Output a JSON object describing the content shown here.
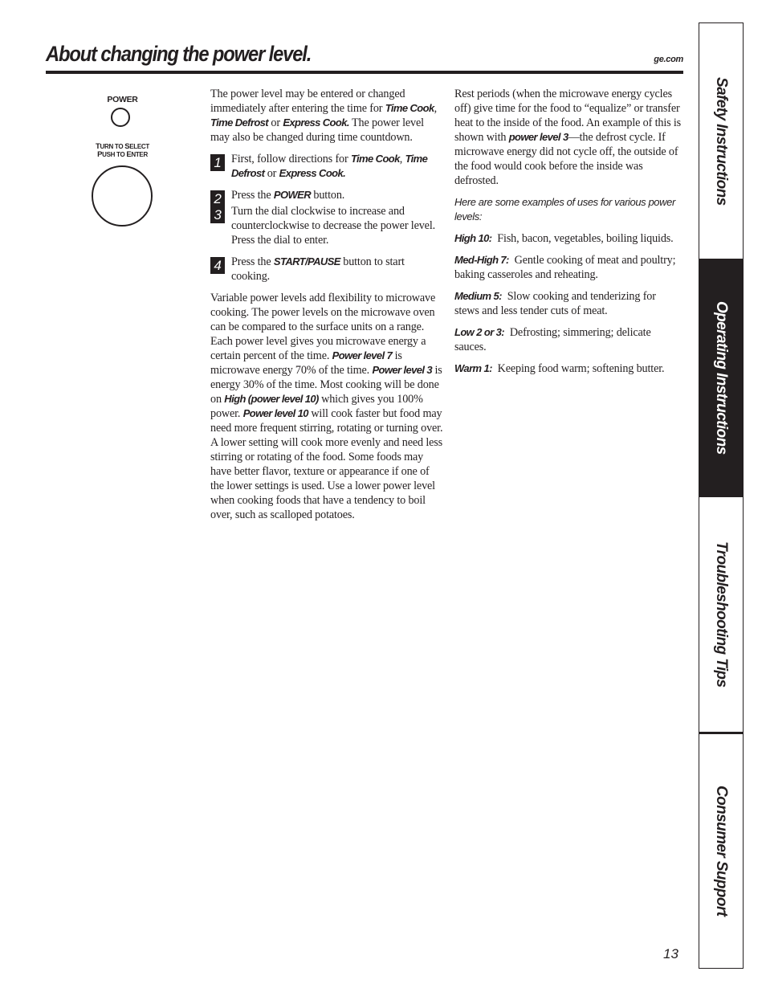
{
  "header": {
    "title": "About changing the power level.",
    "site": "ge.com"
  },
  "control_panel": {
    "power_label": "POWER",
    "dial_label_line1": [
      "T",
      "URN TO ",
      "S",
      "ELECT"
    ],
    "dial_label_line2": [
      "P",
      "USH TO ",
      "E",
      "NTER"
    ]
  },
  "column1": {
    "intro": {
      "t1": "The power level may be entered or changed immediately after entering the time for ",
      "b1": "Time Cook",
      "t2": ", ",
      "b2": "Time Defrost",
      "t3": " or ",
      "b3": "Express Cook.",
      "t4": " The power level may also be changed during time countdown."
    },
    "steps": [
      {
        "num": "1",
        "t1": "First, follow directions for ",
        "b1": "Time Cook",
        "t2": ", ",
        "b2": "Time Defrost",
        "t3": " or ",
        "b3": "Express Cook.",
        "t4": ""
      },
      {
        "num": "2",
        "t1": "Press the ",
        "b1": "POWER",
        "t2": " button."
      },
      {
        "num": "3",
        "t1": "Turn the dial clockwise to increase and counterclockwise to decrease the power level. Press the dial to enter."
      },
      {
        "num": "4",
        "t1": "Press the ",
        "b1": "START/PAUSE",
        "t2": " button to start cooking."
      }
    ],
    "body": {
      "t1": "Variable power levels add flexibility to microwave cooking. The power levels on the microwave oven can be compared to the surface units on a range. Each power level gives you microwave energy a certain percent of the time. ",
      "b1": "Power level 7",
      "t2": " is microwave energy 70% of the time. ",
      "b2": "Power level 3",
      "t3": " is energy 30% of the time. Most cooking will be done on ",
      "b3": "High (power level 10)",
      "t4": " which gives you 100% power. ",
      "b4": "Power level 10",
      "t5": " will cook faster but food may need more frequent stirring, rotating or turning over. A lower setting will cook more evenly and need less stirring or rotating of the food. Some foods may have better flavor, texture or appearance if one of the lower settings is used. Use a lower power level when cooking foods that have a tendency to boil over, such as scalloped potatoes."
    }
  },
  "column2": {
    "rest": {
      "t1": "Rest periods (when the microwave energy cycles off) give time for the food to “equalize” or transfer heat to the inside of the food. An example of this is shown with ",
      "b1": "power level 3",
      "t2": "—the defrost cycle. If microwave energy did not cycle off, the outside of the food would cook before the inside was defrosted."
    },
    "examples_intro": "Here are some examples of uses for various power levels:",
    "levels": [
      {
        "label": "High 10:",
        "text": "Fish, bacon, vegetables, boiling liquids."
      },
      {
        "label": "Med-High 7:",
        "text": "Gentle cooking of meat and poultry; baking casseroles and reheating."
      },
      {
        "label": "Medium 5:",
        "text": "Slow cooking and tenderizing for stews and less tender cuts of meat."
      },
      {
        "label": "Low 2 or 3:",
        "text": "Defrosting; simmering; delicate sauces."
      },
      {
        "label": "Warm 1:",
        "text": "Keeping food warm; softening butter."
      }
    ]
  },
  "side_tabs": [
    {
      "label": "Safety Instructions",
      "active": false
    },
    {
      "label": "Operating Instructions",
      "active": true
    },
    {
      "label": "Troubleshooting Tips",
      "active": false
    },
    {
      "label": "Consumer Support",
      "active": false
    }
  ],
  "colors": {
    "ink": "#231f20",
    "paper": "#ffffff"
  },
  "page_number": "13"
}
